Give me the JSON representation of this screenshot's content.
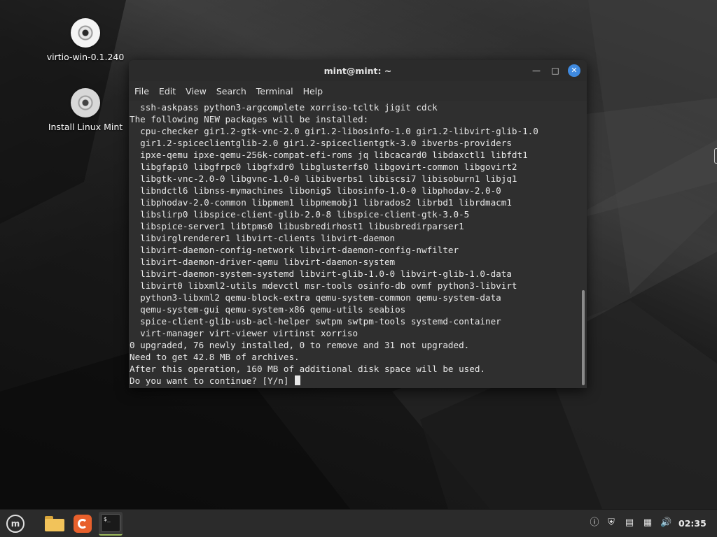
{
  "desktop": {
    "icons": [
      {
        "label": "virtio-win-0.1.240",
        "icon": "disc-icon"
      },
      {
        "label": "Install Linux Mint",
        "icon": "disc-icon"
      }
    ]
  },
  "terminal": {
    "title": "mint@mint: ~",
    "menu": [
      "File",
      "Edit",
      "View",
      "Search",
      "Terminal",
      "Help"
    ],
    "lines": [
      "  ssh-askpass python3-argcomplete xorriso-tcltk jigit cdck",
      "The following NEW packages will be installed:",
      "  cpu-checker gir1.2-gtk-vnc-2.0 gir1.2-libosinfo-1.0 gir1.2-libvirt-glib-1.0",
      "  gir1.2-spiceclientglib-2.0 gir1.2-spiceclientgtk-3.0 ibverbs-providers",
      "  ipxe-qemu ipxe-qemu-256k-compat-efi-roms jq libcacard0 libdaxctl1 libfdt1",
      "  libgfapi0 libgfrpc0 libgfxdr0 libglusterfs0 libgovirt-common libgovirt2",
      "  libgtk-vnc-2.0-0 libgvnc-1.0-0 libibverbs1 libiscsi7 libisoburn1 libjq1",
      "  libndctl6 libnss-mymachines libonig5 libosinfo-1.0-0 libphodav-2.0-0",
      "  libphodav-2.0-common libpmem1 libpmemobj1 librados2 librbd1 librdmacm1",
      "  libslirp0 libspice-client-glib-2.0-8 libspice-client-gtk-3.0-5",
      "  libspice-server1 libtpms0 libusbredirhost1 libusbredirparser1",
      "  libvirglrenderer1 libvirt-clients libvirt-daemon",
      "  libvirt-daemon-config-network libvirt-daemon-config-nwfilter",
      "  libvirt-daemon-driver-qemu libvirt-daemon-system",
      "  libvirt-daemon-system-systemd libvirt-glib-1.0-0 libvirt-glib-1.0-data",
      "  libvirt0 libxml2-utils mdevctl msr-tools osinfo-db ovmf python3-libvirt",
      "  python3-libxml2 qemu-block-extra qemu-system-common qemu-system-data",
      "  qemu-system-gui qemu-system-x86 qemu-utils seabios",
      "  spice-client-glib-usb-acl-helper swtpm swtpm-tools systemd-container",
      "  virt-manager virt-viewer virtinst xorriso",
      "0 upgraded, 76 newly installed, 0 to remove and 31 not upgraded.",
      "Need to get 42.8 MB of archives.",
      "After this operation, 160 MB of additional disk space will be used.",
      "Do you want to continue? [Y/n] "
    ],
    "scroll_position": 1.0,
    "scroll_visible_fraction": 0.33
  },
  "taskbar": {
    "launchers": [
      {
        "name": "menu",
        "icon": "mint-logo-icon"
      },
      {
        "name": "files",
        "icon": "folder-icon"
      },
      {
        "name": "firefox",
        "icon": "firefox-icon"
      },
      {
        "name": "terminal",
        "icon": "terminal-icon",
        "active": true
      }
    ],
    "tray": [
      "notification-icon",
      "shield-icon",
      "clipboard-icon",
      "network-icon",
      "volume-icon"
    ],
    "clock": "02:35"
  }
}
